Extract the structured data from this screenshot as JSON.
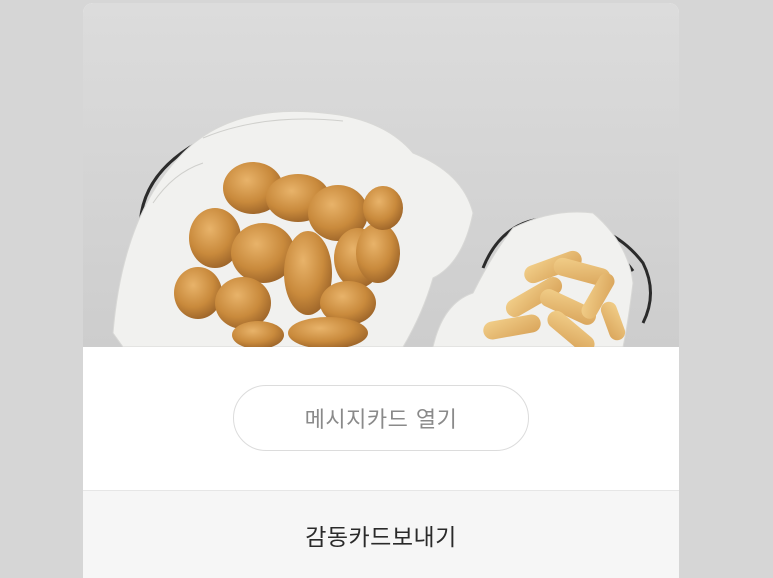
{
  "hero": {
    "image_subject": "fried-chicken-and-potato-wedges-photo"
  },
  "message_card": {
    "open_label": "메시지카드 열기"
  },
  "footer": {
    "send_label": "감동카드보내기"
  },
  "colors": {
    "page_background": "#d6d6d6",
    "hero_background": "#d4d4d4",
    "button_border": "#dcdcdc",
    "button_text": "#8a8a8a",
    "footer_background": "#f6f6f6",
    "footer_text": "#2a2a2a"
  }
}
